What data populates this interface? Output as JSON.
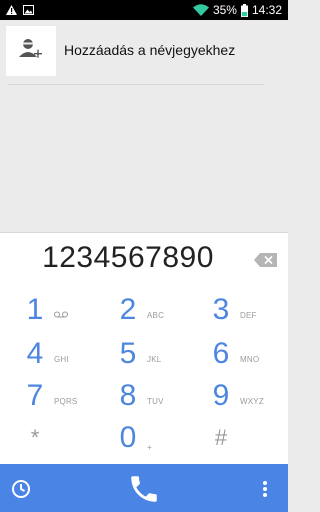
{
  "status": {
    "battery": "35%",
    "time": "14:32"
  },
  "suggestion": {
    "add_contact_label": "Hozzáadás a névjegyekhez"
  },
  "dialer": {
    "number": "1234567890"
  },
  "keys": [
    {
      "digit": "1",
      "letters": "QO"
    },
    {
      "digit": "2",
      "letters": "ABC"
    },
    {
      "digit": "3",
      "letters": "DEF"
    },
    {
      "digit": "4",
      "letters": "GHI"
    },
    {
      "digit": "5",
      "letters": "JKL"
    },
    {
      "digit": "6",
      "letters": "MNO"
    },
    {
      "digit": "7",
      "letters": "PQRS"
    },
    {
      "digit": "8",
      "letters": "TUV"
    },
    {
      "digit": "9",
      "letters": "WXYZ"
    },
    {
      "digit": "*",
      "letters": ""
    },
    {
      "digit": "0",
      "letters": "+"
    },
    {
      "digit": "#",
      "letters": ""
    }
  ],
  "icons": {
    "warning": "warning-icon",
    "image": "image-icon",
    "wifi": "wifi-icon",
    "battery": "battery-icon",
    "add_contact": "add-contact-icon",
    "backspace": "backspace-icon",
    "history": "history-icon",
    "call": "phone-icon",
    "overflow": "overflow-menu-icon"
  },
  "colors": {
    "accent": "#4a85e6",
    "digit": "#4d86e0",
    "battery_fill": "#35c9a1",
    "wifi": "#35c9a1"
  }
}
